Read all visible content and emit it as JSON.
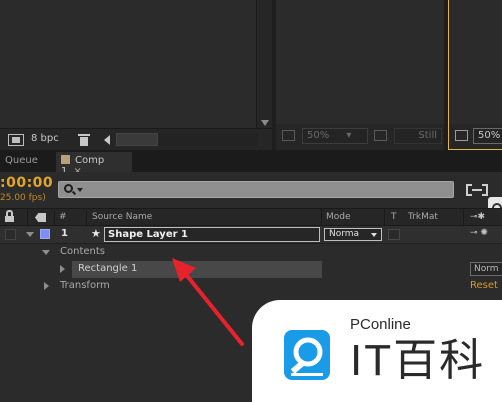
{
  "project_panel": {
    "bpc": "8 bpc"
  },
  "comp_viewer": {
    "zoom": "50%",
    "still": "Still"
  },
  "comp_viewer_2": {
    "zoom": "50%"
  },
  "tabs": [
    {
      "label": "Queue"
    },
    {
      "label": "Comp 1",
      "close": "×"
    }
  ],
  "timeline": {
    "timecode": ":00:00",
    "fps": "25.00 fps)",
    "columns": {
      "num": "#",
      "source": "Source Name",
      "mode": "Mode",
      "t": "T",
      "trkmat": "TrkMat"
    },
    "layer": {
      "number": "1",
      "name": "Shape Layer 1",
      "mode": "Norma",
      "color": "#7f8ef0"
    },
    "contents_label": "Contents",
    "rectangle_label": "Rectangle 1",
    "rectangle_mode": "Norm",
    "transform_label": "Transform",
    "reset_label": "Reset"
  },
  "watermark": {
    "brand": "PConline",
    "text": "IT百科"
  }
}
